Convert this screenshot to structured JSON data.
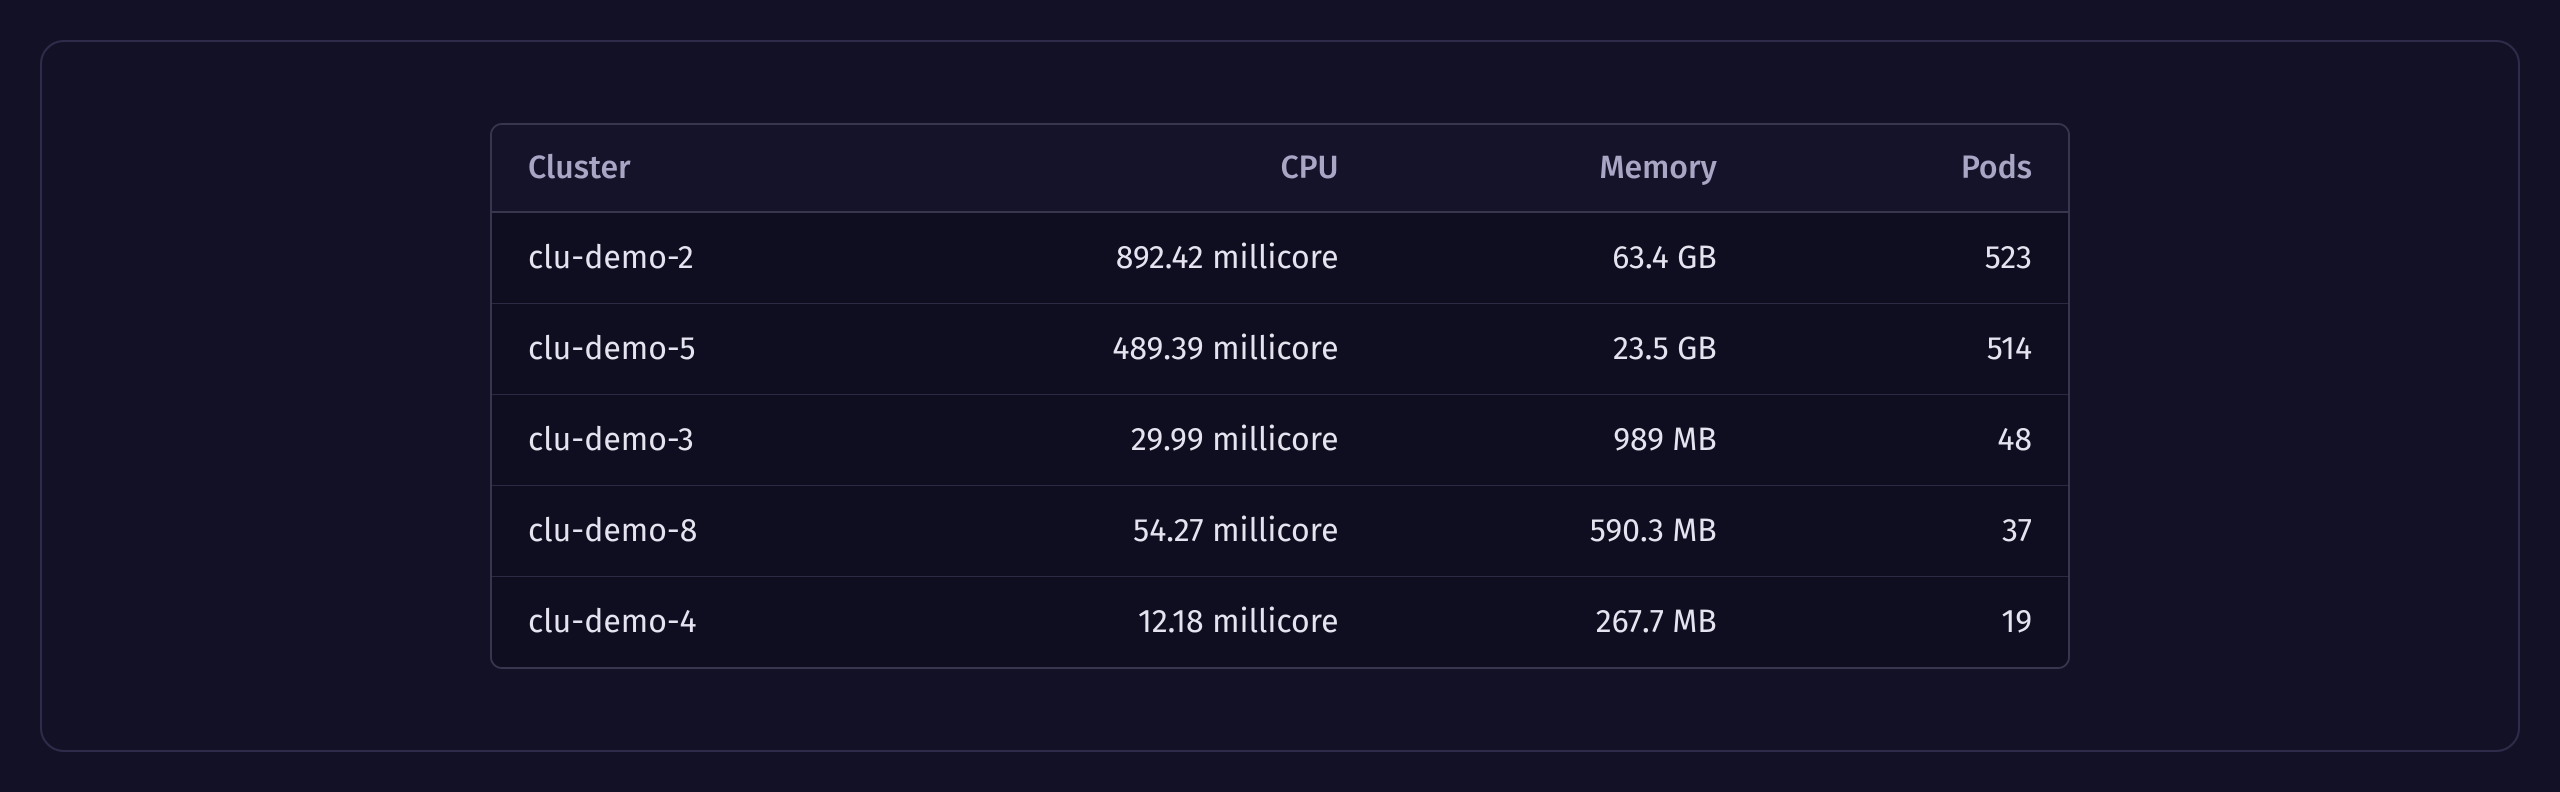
{
  "table": {
    "headers": {
      "cluster": "Cluster",
      "cpu": "CPU",
      "memory": "Memory",
      "pods": "Pods"
    },
    "rows": [
      {
        "cluster": "clu-demo-2",
        "cpu": "892.42 millicore",
        "memory": "63.4 GB",
        "pods": "523"
      },
      {
        "cluster": "clu-demo-5",
        "cpu": "489.39 millicore",
        "memory": "23.5 GB",
        "pods": "514"
      },
      {
        "cluster": "clu-demo-3",
        "cpu": "29.99 millicore",
        "memory": "989 MB",
        "pods": "48"
      },
      {
        "cluster": "clu-demo-8",
        "cpu": "54.27 millicore",
        "memory": "590.3 MB",
        "pods": "37"
      },
      {
        "cluster": "clu-demo-4",
        "cpu": "12.18 millicore",
        "memory": "267.7 MB",
        "pods": "19"
      }
    ]
  }
}
